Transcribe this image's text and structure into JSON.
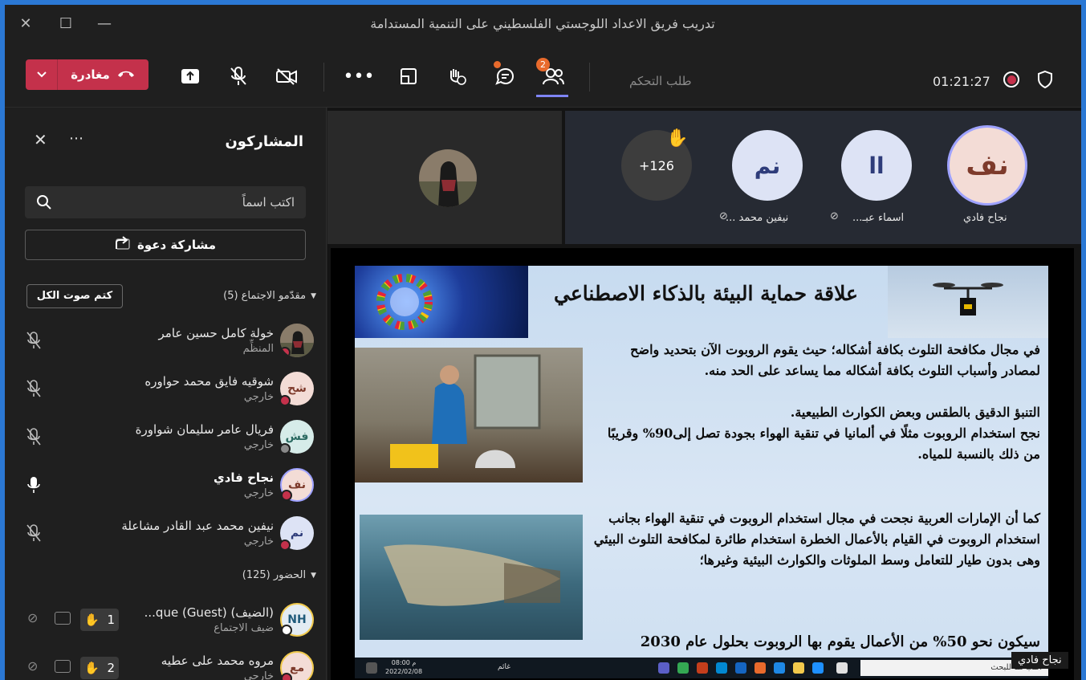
{
  "window": {
    "title": "تدريب فريق الاعداد اللوجستي الفلسطيني على التنمية المستدامة"
  },
  "toolbar": {
    "leave_label": "مغادرة",
    "request_control": "طلب التحكم",
    "timer": "01:21:27",
    "participants_badge": "2",
    "accent": "#c4314b"
  },
  "panel": {
    "title": "المشاركون",
    "search_placeholder": "اكتب اسماً",
    "invite_label": "مشاركة دعوة",
    "presenters_section": "مقدّمو الاجتماع (5)",
    "mute_all": "كتم صوت الكل",
    "attendees_section": "الحضور (125)",
    "presenters": [
      {
        "initials": "",
        "name": "خولة كامل حسين عامر",
        "role": "المنظِّم"
      },
      {
        "initials": "شح",
        "name": "شوقيه فايق محمد حواوره",
        "role": "خارجي"
      },
      {
        "initials": "فش",
        "name": "فريال عامر سليمان شواورة",
        "role": "خارجي"
      },
      {
        "initials": "نف",
        "name": "نجاح فادي",
        "role": "خارجي"
      },
      {
        "initials": "نم",
        "name": "نيفين محمد عبد القادر مشاعلة",
        "role": "خارجي"
      }
    ],
    "attendees": [
      {
        "initials": "NH",
        "name": "(الضيف) (Guest) que...",
        "role": "ضيف الاجتماع",
        "hand": "1"
      },
      {
        "initials": "مع",
        "name": "مروه محمد على عطيه",
        "role": "خارجي",
        "hand": "2"
      }
    ]
  },
  "stage": {
    "more_count": "+126",
    "tiles": [
      {
        "initials": "نف",
        "name": "نجاح فادي"
      },
      {
        "initials": "اا",
        "name": "اسماء عبـ..."
      },
      {
        "initials": "نم",
        "name": "نيفين محمد ..."
      }
    ],
    "presenter_label": "نجاح فادي"
  },
  "slide": {
    "title": "علاقة حماية البيئة بالذكاء الاصطناعي",
    "para1": "في مجال مكافحة التلوث بكافة أشكاله؛ حيث يقوم الروبوت الآن بتحديد واضح لمصادر وأسباب التلوث بكافة أشكاله مما يساعد على الحد منه.",
    "para2": "التنبؤ الدقيق بالطقس وبعض الكوارث الطبيعية.",
    "para3": "نجح استخدام الروبوت مثلًا في ألمانيا في تنقية الهواء بجودة تصل إلى90% وقريبًا من ذلك بالنسبة للمياه.",
    "para4": "كما أن الإمارات العربية نجحت في مجال استخدام الروبوت في تنقية الهواء بجانب استخدام الروبوت في القيام بالأعمال الخطرة  استخدام طائرة لمكافحة التلوث البيئي وهى بدون طيار للتعامل وسط الملوثات والكوارث البيئية وغيرها؛",
    "para5": "سيكون نحو 50% من الأعمال يقوم بها الروبوت بحلول عام 2030",
    "taskbar_search": "اكتب هنا للبحث",
    "taskbar_time": "08:00 م",
    "taskbar_date": "2022/02/08",
    "taskbar_weather": "غائم"
  }
}
